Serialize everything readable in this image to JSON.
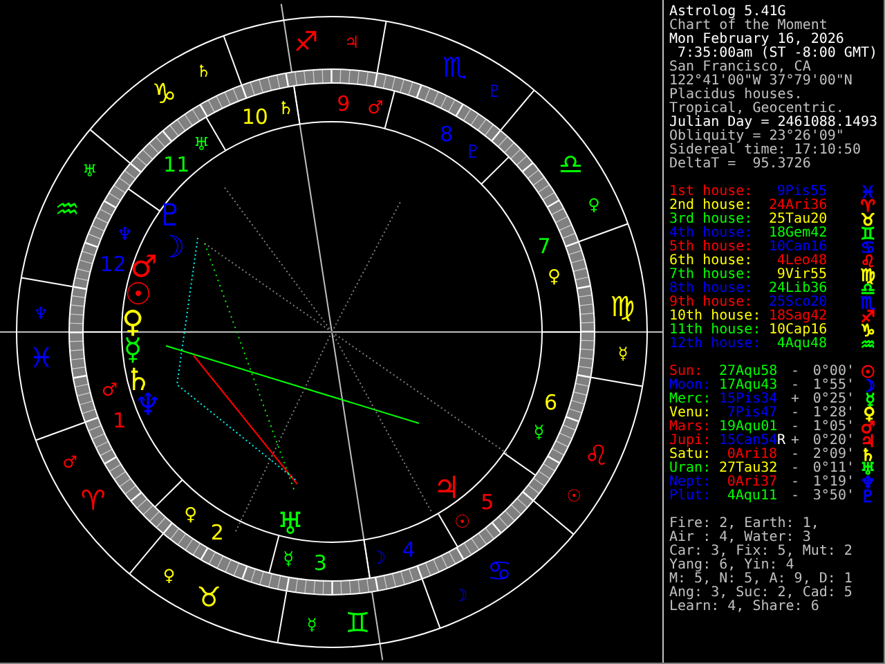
{
  "chart": {
    "signs": [
      {
        "glyph": "♈",
        "color": "#ff0000",
        "ruler": "♂"
      },
      {
        "glyph": "♉",
        "color": "#ffff00",
        "ruler": "♀"
      },
      {
        "glyph": "♊",
        "color": "#00ff00",
        "ruler": "☿"
      },
      {
        "glyph": "♋",
        "color": "#0000ff",
        "ruler": "☽"
      },
      {
        "glyph": "♌",
        "color": "#ff0000",
        "ruler": "☉"
      },
      {
        "glyph": "♍",
        "color": "#ffff00",
        "ruler": "☿"
      },
      {
        "glyph": "♎",
        "color": "#00ff00",
        "ruler": "♀"
      },
      {
        "glyph": "♏",
        "color": "#0000ff",
        "ruler": "♇"
      },
      {
        "glyph": "♐",
        "color": "#ff0000",
        "ruler": "♃"
      },
      {
        "glyph": "♑",
        "color": "#ffff00",
        "ruler": "♄"
      },
      {
        "glyph": "♒",
        "color": "#00ff00",
        "ruler": "♅"
      },
      {
        "glyph": "♓",
        "color": "#0000ff",
        "ruler": "♆"
      }
    ],
    "houses": [
      {
        "number": "1",
        "color": "#ff0000",
        "ruler": {
          "glyph": "♂",
          "color": "#ff0000"
        }
      },
      {
        "number": "2",
        "color": "#ffff00",
        "ruler": {
          "glyph": "♀",
          "color": "#ffff00"
        }
      },
      {
        "number": "3",
        "color": "#00ff00",
        "ruler": {
          "glyph": "☿",
          "color": "#00ff00"
        }
      },
      {
        "number": "4",
        "color": "#0000ff",
        "ruler": {
          "glyph": "☽",
          "color": "#0000ff"
        }
      },
      {
        "number": "5",
        "color": "#ff0000",
        "ruler": {
          "glyph": "☉",
          "color": "#ff0000"
        }
      },
      {
        "number": "6",
        "color": "#ffff00",
        "ruler": {
          "glyph": "☿",
          "color": "#00ff00"
        }
      },
      {
        "number": "7",
        "color": "#00ff00",
        "ruler": {
          "glyph": "♀",
          "color": "#ffff00"
        }
      },
      {
        "number": "8",
        "color": "#0000ff",
        "ruler": {
          "glyph": "♇",
          "color": "#0000ff"
        }
      },
      {
        "number": "9",
        "color": "#ff0000",
        "ruler": {
          "glyph": "♂",
          "color": "#ff0000"
        }
      },
      {
        "number": "10",
        "color": "#ffff00",
        "ruler": {
          "glyph": "♄",
          "color": "#ffff00"
        }
      },
      {
        "number": "11",
        "color": "#00ff00",
        "ruler": {
          "glyph": "♅",
          "color": "#00ff00"
        }
      },
      {
        "number": "12",
        "color": "#0000ff",
        "ruler": {
          "glyph": "♆",
          "color": "#0000ff"
        }
      }
    ],
    "planets": [
      {
        "glyph": "♇",
        "color": "#0000ff"
      },
      {
        "glyph": "☽",
        "color": "#0000ff"
      },
      {
        "glyph": "♂",
        "color": "#ff0000"
      },
      {
        "glyph": "☉",
        "color": "#ff0000"
      },
      {
        "glyph": "♀",
        "color": "#ffff00"
      },
      {
        "glyph": "☿",
        "color": "#00ff00"
      },
      {
        "glyph": "♄",
        "color": "#ffff00"
      },
      {
        "glyph": "♆",
        "color": "#0000ff"
      },
      {
        "glyph": "♃",
        "color": "#ff0000"
      },
      {
        "glyph": "♅",
        "color": "#00ff00"
      }
    ]
  },
  "info": [
    {
      "text": "Astrolog 5.41G",
      "bright": true
    },
    {
      "text": "Chart of the Moment",
      "bright": false
    },
    {
      "text": "Mon February 16, 2026",
      "bright": true
    },
    {
      "text": " 7:35:00am (ST -8:00 GMT)",
      "bright": true
    },
    {
      "text": "San Francisco, CA",
      "bright": false
    },
    {
      "text": "122°41'00\"W 37°79'00\"N",
      "bright": false
    },
    {
      "text": "Placidus houses.",
      "bright": false
    },
    {
      "text": "Tropical, Geocentric.",
      "bright": false
    },
    {
      "text": "Julian Day = 2461088.1493",
      "bright": true
    },
    {
      "text": "Obliquity = 23°26'09\"",
      "bright": false
    },
    {
      "text": "Sidereal time: 17:10:50",
      "bright": false
    },
    {
      "text": "DeltaT =  95.3726",
      "bright": false
    }
  ],
  "houses": [
    {
      "label": {
        "text": "1st house:",
        "color": "#ff0000"
      },
      "value": {
        "text": "9Pis55",
        "color": "#0000ff"
      },
      "glyph": "♓"
    },
    {
      "label": {
        "text": "2nd house:",
        "color": "#ffff00"
      },
      "value": {
        "text": "24Ari36",
        "color": "#ff0000"
      },
      "glyph": "♈"
    },
    {
      "label": {
        "text": "3rd house:",
        "color": "#00ff00"
      },
      "value": {
        "text": "25Tau20",
        "color": "#ffff00"
      },
      "glyph": "♉"
    },
    {
      "label": {
        "text": "4th house:",
        "color": "#0000ff"
      },
      "value": {
        "text": "18Gem42",
        "color": "#00ff00"
      },
      "glyph": "♊"
    },
    {
      "label": {
        "text": "5th house:",
        "color": "#ff0000"
      },
      "value": {
        "text": "10Can16",
        "color": "#0000ff"
      },
      "glyph": "♋"
    },
    {
      "label": {
        "text": "6th house:",
        "color": "#ffff00"
      },
      "value": {
        "text": "4Leo48",
        "color": "#ff0000"
      },
      "glyph": "♌"
    },
    {
      "label": {
        "text": "7th house:",
        "color": "#00ff00"
      },
      "value": {
        "text": "9Vir55",
        "color": "#ffff00"
      },
      "glyph": "♍"
    },
    {
      "label": {
        "text": "8th house:",
        "color": "#0000ff"
      },
      "value": {
        "text": "24Lib36",
        "color": "#00ff00"
      },
      "glyph": "♎"
    },
    {
      "label": {
        "text": "9th house:",
        "color": "#ff0000"
      },
      "value": {
        "text": "25Sco20",
        "color": "#0000ff"
      },
      "glyph": "♏"
    },
    {
      "label": {
        "text": "10th house:",
        "color": "#ffff00"
      },
      "value": {
        "text": "18Sag42",
        "color": "#ff0000"
      },
      "glyph": "♐"
    },
    {
      "label": {
        "text": "11th house:",
        "color": "#00ff00"
      },
      "value": {
        "text": "10Cap16",
        "color": "#ffff00"
      },
      "glyph": "♑"
    },
    {
      "label": {
        "text": "12th house:",
        "color": "#0000ff"
      },
      "value": {
        "text": "4Aqu48",
        "color": "#00ff00"
      },
      "glyph": "♒"
    }
  ],
  "planets": [
    {
      "name": {
        "text": "Sun:",
        "color": "#ff0000"
      },
      "position": {
        "text": "27Aqu58",
        "color": "#00ff00"
      },
      "sign": "-",
      "speed": "0°00'",
      "glyph": {
        "text": "☉",
        "color": "#ff0000"
      }
    },
    {
      "name": {
        "text": "Moon:",
        "color": "#0000ff"
      },
      "position": {
        "text": "17Aqu43",
        "color": "#00ff00"
      },
      "sign": "-",
      "speed": "1°55'",
      "glyph": {
        "text": "☽",
        "color": "#0000ff"
      }
    },
    {
      "name": {
        "text": "Merc:",
        "color": "#00ff00"
      },
      "position": {
        "text": "15Pis34",
        "color": "#0000ff"
      },
      "sign": "+",
      "speed": "0°25'",
      "glyph": {
        "text": "☿",
        "color": "#00ff00"
      }
    },
    {
      "name": {
        "text": "Venu:",
        "color": "#ffff00"
      },
      "position": {
        "text": "7Pis47",
        "color": "#0000ff"
      },
      "sign": "-",
      "speed": "1°28'",
      "glyph": {
        "text": "♀",
        "color": "#ffff00"
      }
    },
    {
      "name": {
        "text": "Mars:",
        "color": "#ff0000"
      },
      "position": {
        "text": "19Aqu01",
        "color": "#00ff00"
      },
      "sign": "-",
      "speed": "1°05'",
      "glyph": {
        "text": "♂",
        "color": "#ff0000"
      }
    },
    {
      "name": {
        "text": "Jupi:",
        "color": "#ff0000"
      },
      "position": {
        "text": "15Can54",
        "color": "#0000ff"
      },
      "retro": "R",
      "sign": "+",
      "speed": "0°20'",
      "glyph": {
        "text": "♃",
        "color": "#ff0000"
      }
    },
    {
      "name": {
        "text": "Satu:",
        "color": "#ffff00"
      },
      "position": {
        "text": "0Ari18",
        "color": "#ff0000"
      },
      "sign": "-",
      "speed": "2°09'",
      "glyph": {
        "text": "♄",
        "color": "#ffff00"
      }
    },
    {
      "name": {
        "text": "Uran:",
        "color": "#00ff00"
      },
      "position": {
        "text": "27Tau32",
        "color": "#ffff00"
      },
      "sign": "-",
      "speed": "0°11'",
      "glyph": {
        "text": "♅",
        "color": "#00ff00"
      }
    },
    {
      "name": {
        "text": "Nept:",
        "color": "#0000ff"
      },
      "position": {
        "text": "0Ari37",
        "color": "#ff0000"
      },
      "sign": "-",
      "speed": "1°19'",
      "glyph": {
        "text": "♆",
        "color": "#0000ff"
      }
    },
    {
      "name": {
        "text": "Plut:",
        "color": "#0000ff"
      },
      "position": {
        "text": "4Aqu11",
        "color": "#00ff00"
      },
      "sign": "-",
      "speed": "3°50'",
      "glyph": {
        "text": "♇",
        "color": "#0000ff"
      }
    }
  ],
  "stats": [
    "Fire: 2, Earth: 1,",
    "Air : 4, Water: 3",
    "Car: 3, Fix: 5, Mut: 2",
    "Yang: 6, Yin: 4",
    "M: 5, N: 5, A: 9, D: 1",
    "Ang: 3, Suc: 2, Cad: 5",
    "Learn: 4, Share: 6"
  ]
}
